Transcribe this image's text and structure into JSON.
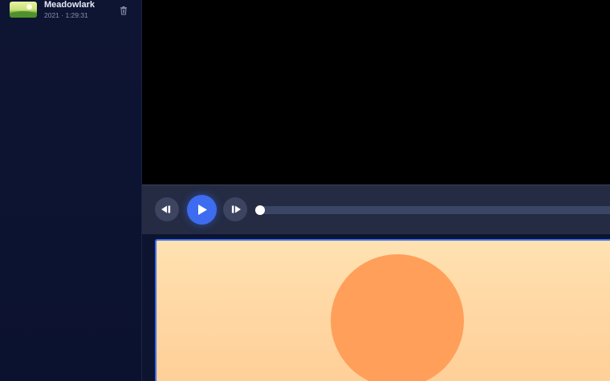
{
  "library": {
    "items": [
      {
        "title": "Meadowlark",
        "meta": "2021 · 1:29:31",
        "thumbnail_icon": "meadow-landscape-thumbnail",
        "delete_icon": "trash-icon"
      }
    ]
  },
  "player": {
    "skip_back_icon": "skip-back-icon",
    "play_icon": "play-icon",
    "skip_forward_icon": "skip-forward-icon",
    "progress": 0.0,
    "colors": {
      "accent": "#3d6cf0",
      "control_bar": "#242b43",
      "track": "#3b4566"
    }
  },
  "artwork": {
    "icon": "sun-artwork",
    "colors": {
      "sky": "#ffd9a6",
      "sun": "#ff9f5a"
    }
  }
}
